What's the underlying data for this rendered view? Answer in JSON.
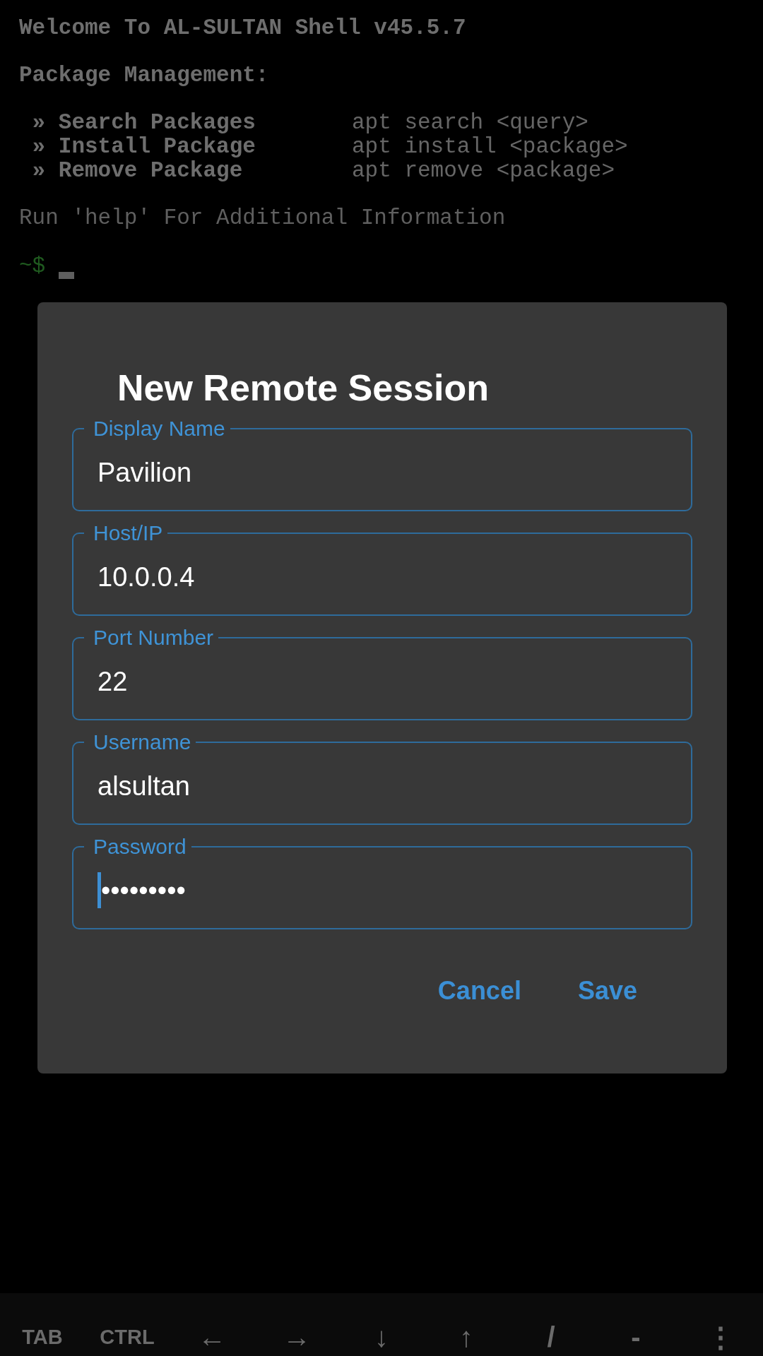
{
  "terminal": {
    "banner": "Welcome To AL-SULTAN Shell v45.5.7",
    "section": "Package Management:",
    "commands": [
      {
        "label": "» Search Packages",
        "command": "apt search <query>"
      },
      {
        "label": "» Install Package",
        "command": "apt install <package>"
      },
      {
        "label": "» Remove Package",
        "command": "apt remove <package>"
      }
    ],
    "hint": "Run 'help' For Additional Information",
    "prompt": "~$"
  },
  "dialog": {
    "title": "New Remote Session",
    "fields": [
      {
        "label": "Display Name",
        "value": "Pavilion",
        "focused": false
      },
      {
        "label": "Host/IP",
        "value": "10.0.0.4",
        "focused": false
      },
      {
        "label": "Port Number",
        "value": "22",
        "focused": false
      },
      {
        "label": "Username",
        "value": "alsultan",
        "focused": false
      },
      {
        "label": "Password",
        "value": "•••••••••",
        "focused": true
      }
    ],
    "buttons": [
      "Cancel",
      "Save"
    ]
  },
  "key_bar": {
    "keys": [
      {
        "label": "TAB",
        "kind": "text"
      },
      {
        "label": "CTRL",
        "kind": "text"
      },
      {
        "label": "←",
        "kind": "symbol"
      },
      {
        "label": "→",
        "kind": "symbol"
      },
      {
        "label": "↓",
        "kind": "symbol"
      },
      {
        "label": "↑",
        "kind": "symbol"
      },
      {
        "label": "/",
        "kind": "symbol"
      },
      {
        "label": "-",
        "kind": "symbol"
      },
      {
        "label": "⋮",
        "kind": "symbol"
      }
    ]
  }
}
